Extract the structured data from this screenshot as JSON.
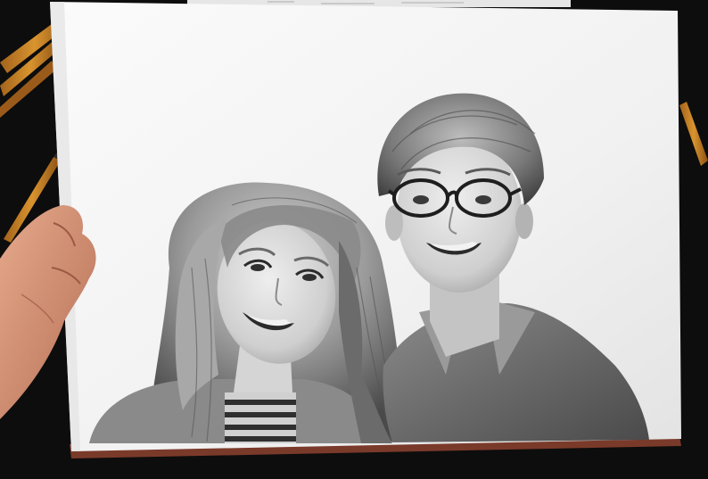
{
  "scene": {
    "subject": "graphite-portrait-drawing",
    "colors": {
      "background": "#0d0d0d",
      "paper": "#f4f4f4",
      "paper_shadow": "#d9d9d9",
      "pencil_wood": "#c8822a",
      "pencil_lead": "#2b2b2b",
      "skin_hand": "#d89678",
      "graphite_dark": "#3a3a3a",
      "graphite_mid": "#8a8a8a",
      "graphite_light": "#c9c9c9",
      "board_edge": "#7a3a2a"
    }
  }
}
